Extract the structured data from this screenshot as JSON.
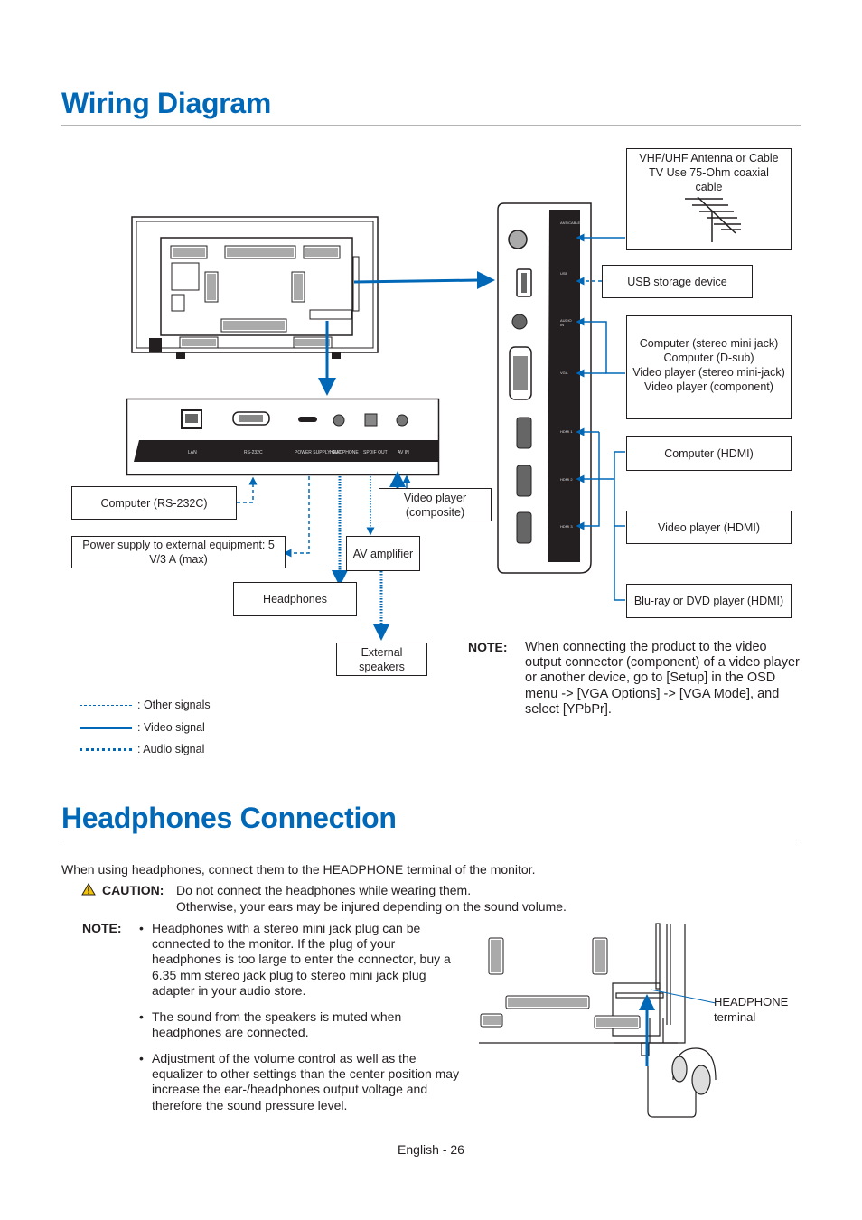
{
  "sections": {
    "wiring": {
      "title": "Wiring Diagram"
    },
    "headphones": {
      "title": "Headphones Connection"
    }
  },
  "wiring": {
    "devices": {
      "antenna": "VHF/UHF Antenna or Cable TV Use 75-Ohm coaxial cable",
      "usb": "USB storage device",
      "analog_group": [
        "Computer (stereo mini jack)",
        "Computer (D-sub)",
        "Video player (stereo mini-jack)",
        "Video player (component)"
      ],
      "computer_hdmi": "Computer (HDMI)",
      "video_hdmi": "Video player (HDMI)",
      "bluray_hdmi": "Blu-ray or DVD player (HDMI)",
      "rs232": "Computer (RS-232C)",
      "power_supply": "Power supply to external equipment: 5 V/3 A (max)",
      "composite": "Video player (composite)",
      "av_amp": "AV amplifier",
      "headphones": "Headphones",
      "speakers": "External speakers"
    },
    "bottom_panel_labels": [
      "LAN",
      "RS-232C",
      "POWER SUPPLY OUT",
      "HEADPHONE",
      "SPDIF OUT",
      "AV IN"
    ],
    "side_panel_labels": [
      "ANT/CABLE",
      "USB",
      "AUDIO IN",
      "VGA",
      "HDMI 1",
      "HDMI 2",
      "HDMI 3"
    ],
    "legend": [
      {
        "style": "dashed",
        "label": ": Other signals"
      },
      {
        "style": "solid",
        "label": ": Video signal"
      },
      {
        "style": "dotted",
        "label": ": Audio signal"
      }
    ],
    "note": {
      "label": "NOTE:",
      "text": "When connecting the product to the video output connector (component) of a video player or another device, go to [Setup] in the OSD menu -> [VGA Options] -> [VGA Mode], and select [YPbPr]."
    },
    "colors": {
      "accent": "#0068b7",
      "line": "#231f20"
    }
  },
  "headphones_section": {
    "intro": "When using headphones, connect them to the HEADPHONE terminal of the monitor.",
    "caution": {
      "icon": "warning-triangle-icon",
      "label": "CAUTION:",
      "line1": "Do not connect the headphones while wearing them.",
      "line2": "Otherwise, your ears may be injured depending on the sound volume."
    },
    "note": {
      "label": "NOTE:",
      "bullets": [
        "Headphones with a stereo mini jack plug can be connected to the monitor. If the plug of your headphones is too large to enter the connector, buy a 6.35 mm stereo jack plug to stereo mini jack plug adapter in your audio store.",
        "The sound from the speakers is muted when headphones are connected.",
        "Adjustment of the volume control as well as the equalizer to other settings than the center position may increase the ear-/headphones output voltage and therefore the sound pressure level."
      ]
    },
    "terminal_label_1": "HEADPHONE",
    "terminal_label_2": "terminal"
  },
  "footer": {
    "page": "English - 26"
  }
}
